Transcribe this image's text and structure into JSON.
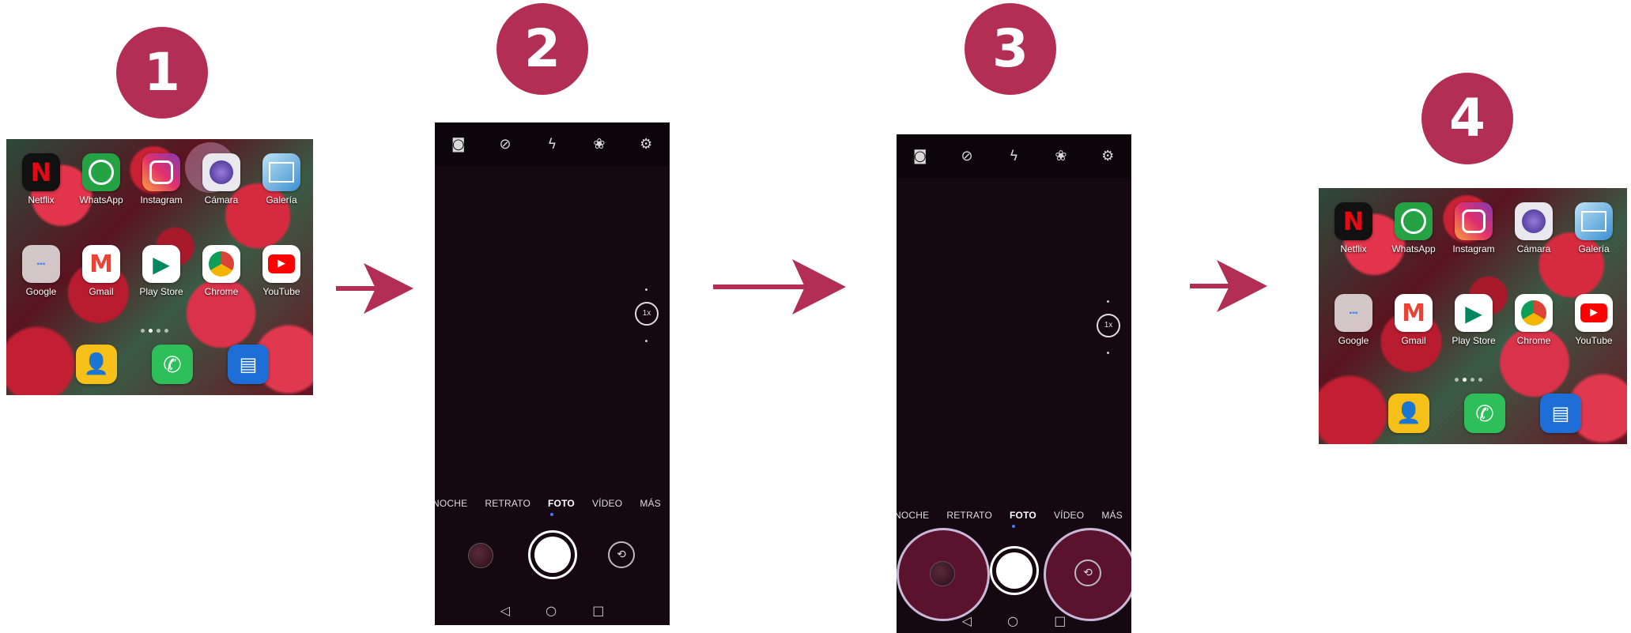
{
  "steps": [
    "1",
    "2",
    "3",
    "4"
  ],
  "home_screen": {
    "rows": [
      [
        {
          "label": "Netflix",
          "icon": "netflix-icon"
        },
        {
          "label": "WhatsApp",
          "icon": "whatsapp-icon"
        },
        {
          "label": "Instagram",
          "icon": "instagram-icon"
        },
        {
          "label": "Cámara",
          "icon": "camera-app-icon"
        },
        {
          "label": "Galería",
          "icon": "gallery-icon"
        }
      ],
      [
        {
          "label": "Google",
          "icon": "google-folder-icon"
        },
        {
          "label": "Gmail",
          "icon": "gmail-icon"
        },
        {
          "label": "Play Store",
          "icon": "play-store-icon"
        },
        {
          "label": "Chrome",
          "icon": "chrome-icon"
        },
        {
          "label": "YouTube",
          "icon": "youtube-icon"
        }
      ]
    ],
    "dock": [
      {
        "icon": "contacts-icon"
      },
      {
        "icon": "phone-icon"
      },
      {
        "icon": "messages-icon"
      }
    ]
  },
  "camera": {
    "modes": [
      "NOCHE",
      "RETRATO",
      "FOTO",
      "VÍDEO",
      "MÁS"
    ],
    "selected_mode": "FOTO",
    "zoom": "1x",
    "top_icons": [
      "focus-icon",
      "ai-off-icon",
      "flash-off-icon",
      "filter-icon",
      "settings-icon"
    ],
    "nav": [
      "◁",
      "○",
      "□"
    ]
  },
  "colors": {
    "accent": "#b32e55",
    "highlight": "#c9b9d8"
  }
}
